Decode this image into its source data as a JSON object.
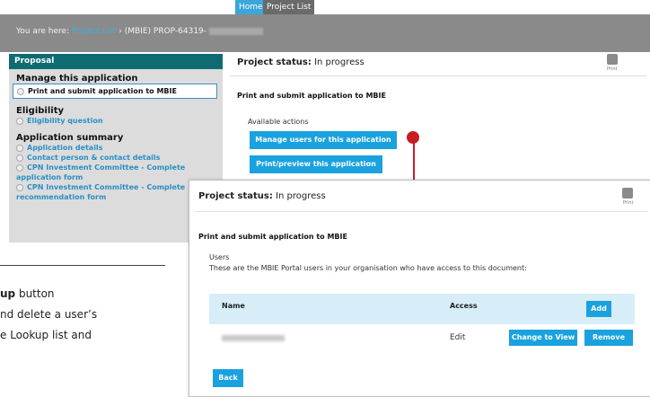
{
  "top_tabs": {
    "home": "Home",
    "project_list": "Project List"
  },
  "breadcrumb": {
    "prefix": "You are here:",
    "link": "Project List",
    "separator": "›",
    "current": "(MBIE) PROP-64319-"
  },
  "sidebar": {
    "header": "Proposal",
    "sections": [
      {
        "title": "Manage this application",
        "items": [
          "Print and submit application to MBIE"
        ]
      },
      {
        "title": "Eligibility",
        "items": [
          "Eligibility question"
        ]
      },
      {
        "title": "Application summary",
        "items": [
          "Application details",
          "Contact person & contact details",
          "CPN Investment Committee - Complete",
          "application form",
          "CPN Investment Committee - Complete",
          "recommendation form"
        ]
      }
    ]
  },
  "back_panel": {
    "status_label": "Project status:",
    "status_value": "In progress",
    "print_label": "Print",
    "heading": "Print and submit application to MBIE",
    "actions_label": "Available actions",
    "buttons": [
      "Manage users for this application",
      "Print/preview this application"
    ]
  },
  "front_panel": {
    "status_label": "Project status:",
    "status_value": "In progress",
    "print_label": "Print",
    "heading": "Print and submit application to MBIE",
    "users_label": "Users",
    "users_desc": "These are the MBIE Portal users in your organisation who have access to this document:",
    "table": {
      "col_name": "Name",
      "col_access": "Access",
      "add_button": "Add",
      "rows": [
        {
          "access": "Edit",
          "change_button": "Change to View",
          "remove_button": "Remove"
        }
      ]
    },
    "back_button": "Back"
  },
  "left_text": {
    "line1_bold": "up",
    "line1_rest": " button",
    "line2": "nd delete a user’s",
    "line3": "e Lookup list and"
  },
  "colors": {
    "accent_blue": "#1aa2df",
    "sidebar_teal": "#0f6b72",
    "arrow_red": "#c81d25"
  }
}
